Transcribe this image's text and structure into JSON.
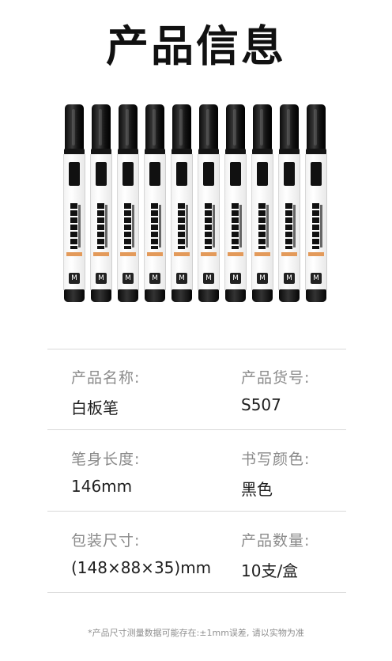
{
  "header": {
    "title": "产品信息"
  },
  "product_image": {
    "count": 10,
    "size_mark": "M"
  },
  "specs": [
    {
      "left_label": "产品名称:",
      "left_value": "白板笔",
      "right_label": "产品货号:",
      "right_value": "S507"
    },
    {
      "left_label": "笔身长度:",
      "left_value": "146mm",
      "right_label": "书写颜色:",
      "right_value": "黑色"
    },
    {
      "left_label": "包装尺寸:",
      "left_value": "(148×88×35)mm",
      "right_label": "产品数量:",
      "right_value": "10支/盒"
    }
  ],
  "footer": {
    "note": "*产品尺寸测量数据可能存在:±1mm误差, 请以实物为准"
  },
  "colors": {
    "marker_body": "#111111",
    "accent_band": "#e39a5a",
    "divider": "#d9d9d9"
  }
}
